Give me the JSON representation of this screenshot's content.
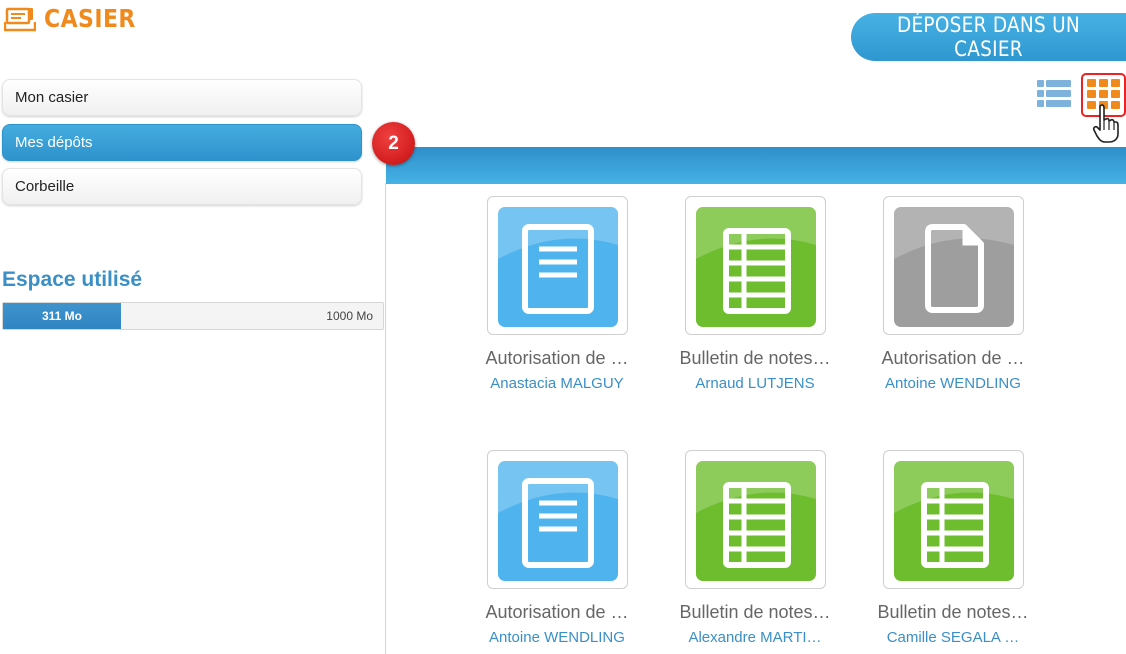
{
  "header": {
    "title": "CASIER",
    "deposit_button": "DÉPOSER DANS UN CASIER"
  },
  "sidebar": {
    "items": [
      {
        "label": "Mon casier",
        "active": false
      },
      {
        "label": "Mes dépôts",
        "active": true
      },
      {
        "label": "Corbeille",
        "active": false
      }
    ],
    "space": {
      "title": "Espace utilisé",
      "used": "311 Mo",
      "total": "1000 Mo",
      "used_fraction": 0.311
    }
  },
  "view": {
    "list_icon": "list-view-icon",
    "grid_icon": "grid-view-icon",
    "selected": "grid"
  },
  "step_badge": "2",
  "files": [
    {
      "name": "Autorisation de …",
      "owner": "Anastacia MALGUY",
      "icon": "document-icon",
      "color": "#4fb4ee"
    },
    {
      "name": "Bulletin de notes…",
      "owner": "Arnaud LUTJENS",
      "icon": "spreadsheet-icon",
      "color": "#6dbd2e"
    },
    {
      "name": "Autorisation de …",
      "owner": "Antoine WENDLING",
      "icon": "generic-file-icon",
      "color": "#9e9e9e"
    },
    {
      "name": "Autorisation de …",
      "owner": "Antoine WENDLING",
      "icon": "document-icon",
      "color": "#4fb4ee"
    },
    {
      "name": "Bulletin de notes…",
      "owner": "Alexandre MARTI…",
      "icon": "spreadsheet-icon",
      "color": "#6dbd2e"
    },
    {
      "name": "Bulletin de notes…",
      "owner": "Camille SEGALA …",
      "icon": "spreadsheet-icon",
      "color": "#6dbd2e"
    }
  ],
  "colors": {
    "accent_blue": "#3a8fc7",
    "brand_orange": "#f08a1c",
    "badge_red": "#d11a1a"
  }
}
